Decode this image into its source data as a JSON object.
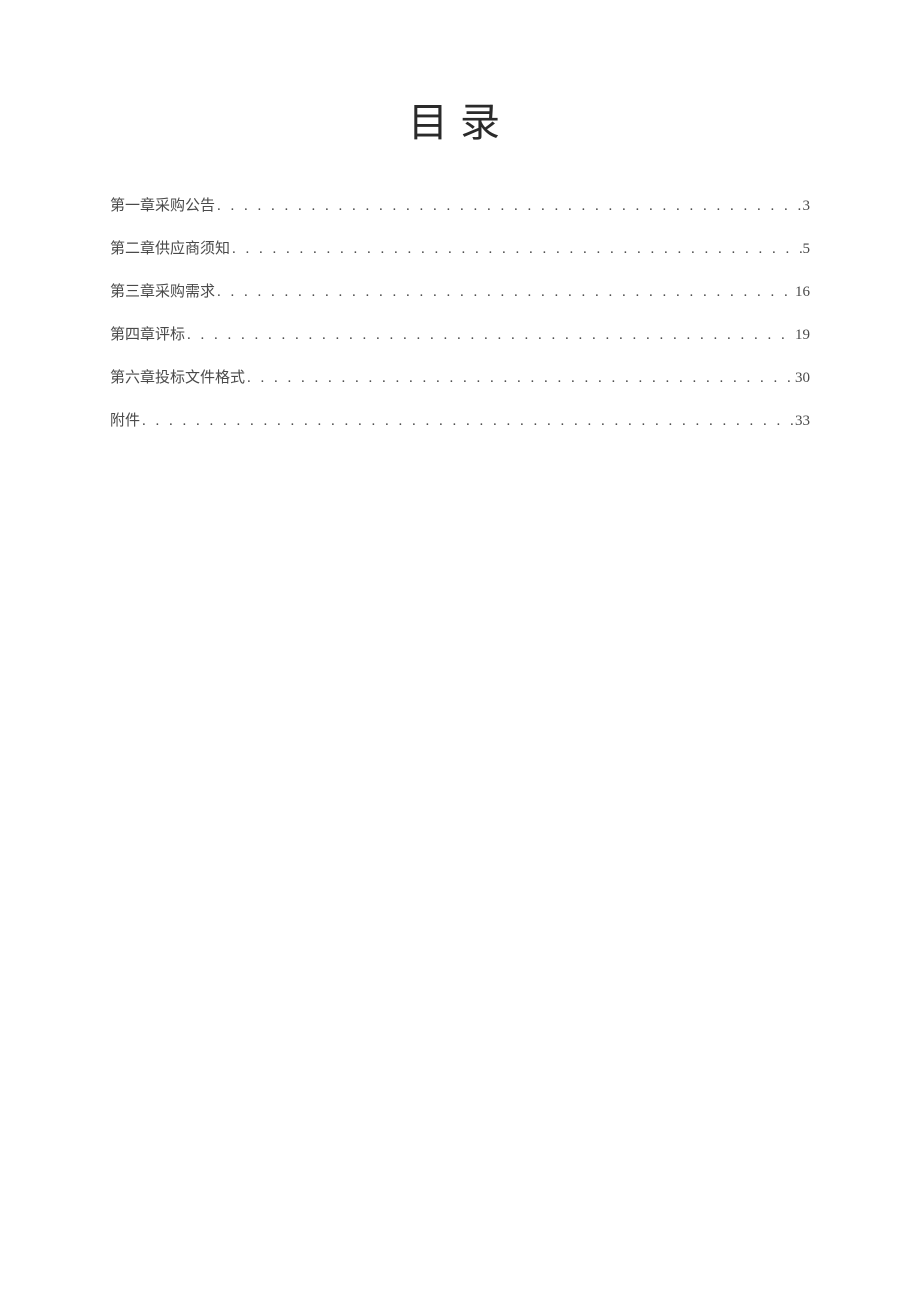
{
  "title": "目录",
  "toc": [
    {
      "label": "第一章采购公告",
      "page": "3"
    },
    {
      "label": "第二章供应商须知",
      "page": "5"
    },
    {
      "label": "第三章采购需求",
      "page": "16"
    },
    {
      "label": "第四章评标",
      "page": "19"
    },
    {
      "label": "第六章投标文件格式",
      "page": "30"
    },
    {
      "label": "附件",
      "page": "33"
    }
  ]
}
